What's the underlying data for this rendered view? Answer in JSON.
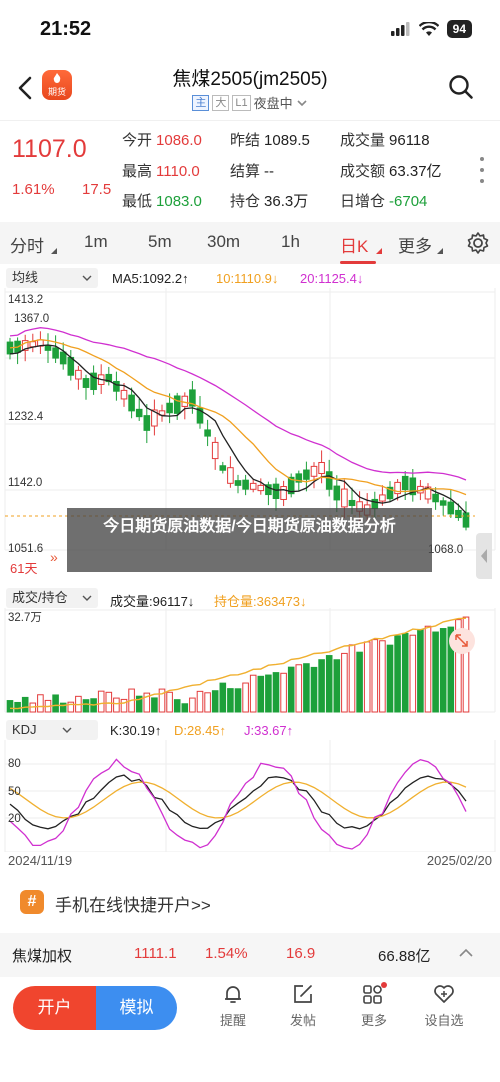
{
  "status_bar": {
    "time": "21:52",
    "battery": "94"
  },
  "nav": {
    "logo_line1": "",
    "logo_line2": "期货",
    "title": "焦煤2505(jm2505)",
    "tags": [
      "主",
      "大",
      "L1"
    ],
    "session": "夜盘中"
  },
  "quote": {
    "price": "1107.0",
    "change_pct": "1.61%",
    "change": "17.5",
    "open_label": "今开",
    "open": "1086.0",
    "prev_close_label": "昨结",
    "prev_close": "1089.5",
    "volume_label": "成交量",
    "volume": "96118",
    "high_label": "最高",
    "high": "1110.0",
    "settle_label": "结算",
    "settle": "--",
    "turnover_label": "成交额",
    "turnover": "63.37亿",
    "low_label": "最低",
    "low": "1083.0",
    "oi_label": "持仓",
    "oi": "36.3万",
    "oi_change_label": "日增仓",
    "oi_change": "-6704"
  },
  "tabs": [
    "分时",
    "1m",
    "5m",
    "30m",
    "1h",
    "日K",
    "更多"
  ],
  "active_tab": "日K",
  "main_chart": {
    "indicator": "均线",
    "ma5": "MA5:1092.2↑",
    "ma10": "10:1110.9↓",
    "ma20": "20:1125.4↓",
    "y_ticks": [
      "1413.2",
      "1232.4",
      "1142.0",
      "1051.6"
    ],
    "high_marker": "1367.0",
    "low_marker": "1068.0",
    "days_label": "61天"
  },
  "volume_chart": {
    "indicator": "成交/持仓",
    "volume": "成交量:96117↓",
    "open_interest": "持仓量:363473↓",
    "y_max": "32.7万"
  },
  "kdj_chart": {
    "indicator": "KDJ",
    "k": "K:30.19↑",
    "d": "D:28.45↑",
    "j": "J:33.67↑",
    "y_ticks": [
      "80",
      "50",
      "20"
    ]
  },
  "date_start": "2024/11/19",
  "date_end": "2025/02/20",
  "overlay_text": "今日期货原油数据/今日期货原油数据分析",
  "promo": {
    "text": "手机在线快捷开户>>"
  },
  "ticker": {
    "name": "焦煤加权",
    "price": "1111.1",
    "pct": "1.54%",
    "change": "16.9",
    "turnover": "66.88亿"
  },
  "bottom_bar": {
    "open_account": "开户",
    "simulate": "模拟",
    "items": [
      "提醒",
      "发帖",
      "更多",
      "设自选"
    ]
  },
  "colors": {
    "up": "#e33b3b",
    "down": "#1da03a",
    "ma5": "#222222",
    "ma10": "#f0a020",
    "ma20": "#d030d0"
  }
}
